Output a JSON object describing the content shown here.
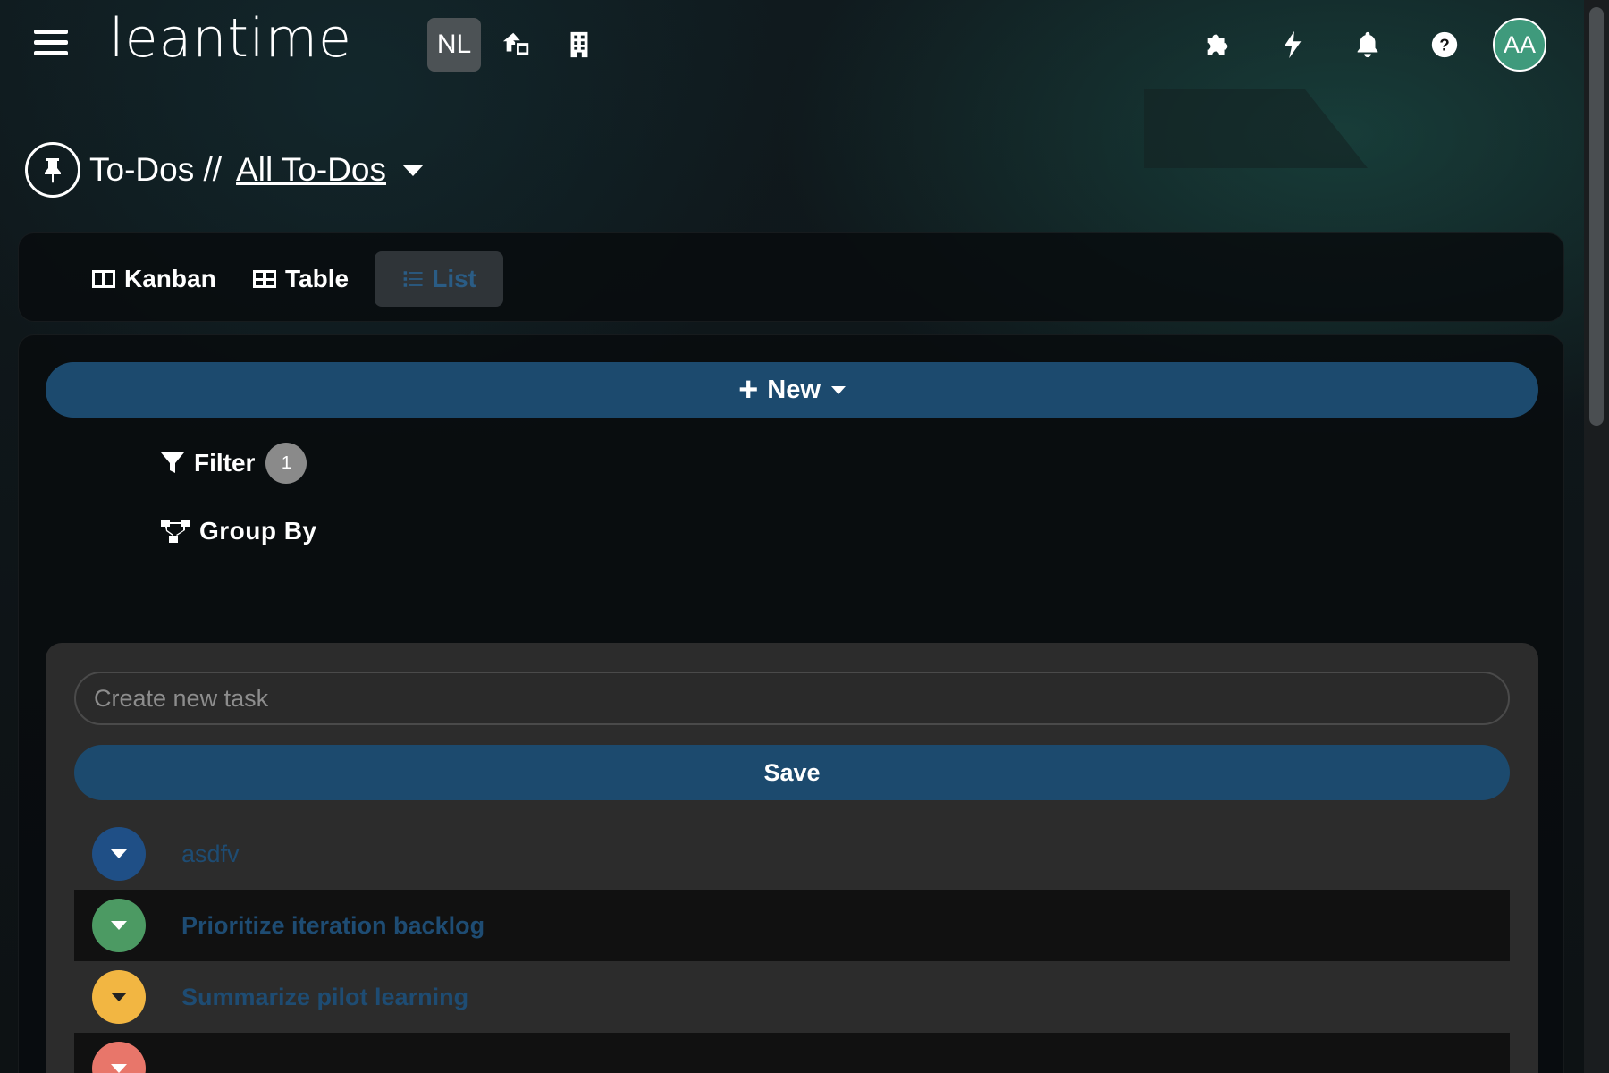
{
  "header": {
    "logo_text": "leantime",
    "project_initials": "NL",
    "avatar_initials": "AA",
    "icons": [
      "menu-icon",
      "home-office-icon",
      "building-icon",
      "puzzle-icon",
      "bolt-icon",
      "bell-icon",
      "help-icon"
    ]
  },
  "page": {
    "title": "To-Dos //",
    "view_link": "All To-Dos "
  },
  "views": {
    "tabs": [
      {
        "label": "Kanban",
        "icon": "columns-icon"
      },
      {
        "label": "Table",
        "icon": "table-icon"
      },
      {
        "label": "List",
        "icon": "list-icon",
        "active": true
      }
    ]
  },
  "toolbar": {
    "new_plus": "+",
    "new_label": "New",
    "filter_label": "Filter",
    "filter_count": "1",
    "group_by_label": "Group By"
  },
  "task_form": {
    "placeholder": "Create new task",
    "value": "",
    "save_label": "Save"
  },
  "tasks": [
    {
      "title": "asdfv",
      "status_color": "#1f4f86"
    },
    {
      "title": "Prioritize iteration backlog",
      "status_color": "#4c9a63"
    },
    {
      "title": "Summarize pilot learning",
      "status_color": "#f2b642"
    },
    {
      "title": "",
      "status_color": "#e8766a"
    }
  ],
  "colors": {
    "primary_button": "#1c4a6e",
    "avatar": "#3f9a7c",
    "task_link": "#1e4c73"
  }
}
